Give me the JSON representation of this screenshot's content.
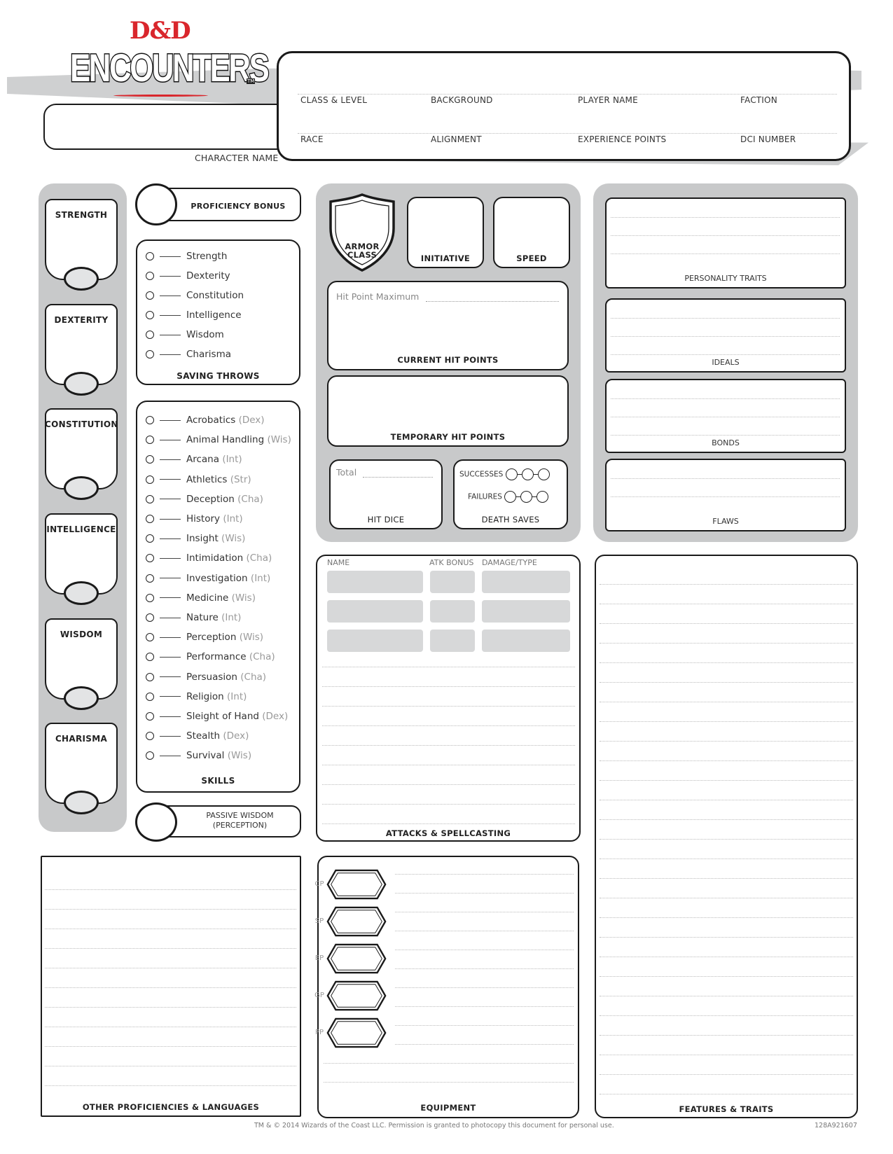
{
  "header": {
    "brand": "D&D",
    "title": "ENCOUNTERS",
    "tm": "TM",
    "character_name_label": "CHARACTER NAME",
    "fields_row1": [
      "CLASS & LEVEL",
      "BACKGROUND",
      "PLAYER NAME",
      "FACTION"
    ],
    "fields_row2": [
      "RACE",
      "ALIGNMENT",
      "EXPERIENCE POINTS",
      "DCI NUMBER"
    ]
  },
  "abilities": [
    "STRENGTH",
    "DEXTERITY",
    "CONSTITUTION",
    "INTELLIGENCE",
    "WISDOM",
    "CHARISMA"
  ],
  "proficiency_bonus_label": "PROFICIENCY BONUS",
  "saving_throws": {
    "title": "SAVING THROWS",
    "items": [
      "Strength",
      "Dexterity",
      "Constitution",
      "Intelligence",
      "Wisdom",
      "Charisma"
    ]
  },
  "skills": {
    "title": "SKILLS",
    "items": [
      {
        "name": "Acrobatics",
        "attr": "(Dex)"
      },
      {
        "name": "Animal Handling",
        "attr": "(Wis)"
      },
      {
        "name": "Arcana",
        "attr": "(Int)"
      },
      {
        "name": "Athletics",
        "attr": "(Str)"
      },
      {
        "name": "Deception",
        "attr": "(Cha)"
      },
      {
        "name": "History",
        "attr": "(Int)"
      },
      {
        "name": "Insight",
        "attr": "(Wis)"
      },
      {
        "name": "Intimidation",
        "attr": "(Cha)"
      },
      {
        "name": "Investigation",
        "attr": "(Int)"
      },
      {
        "name": "Medicine",
        "attr": "(Wis)"
      },
      {
        "name": "Nature",
        "attr": "(Int)"
      },
      {
        "name": "Perception",
        "attr": "(Wis)"
      },
      {
        "name": "Performance",
        "attr": "(Cha)"
      },
      {
        "name": "Persuasion",
        "attr": "(Cha)"
      },
      {
        "name": "Religion",
        "attr": "(Int)"
      },
      {
        "name": "Sleight of Hand",
        "attr": "(Dex)"
      },
      {
        "name": "Stealth",
        "attr": "(Dex)"
      },
      {
        "name": "Survival",
        "attr": "(Wis)"
      }
    ]
  },
  "passive_wisdom": {
    "line1": "PASSIVE WISDOM",
    "line2": "(PERCEPTION)"
  },
  "combat": {
    "armor_class_line1": "ARMOR",
    "armor_class_line2": "CLASS",
    "initiative": "INITIATIVE",
    "speed": "SPEED",
    "hp_max_label": "Hit Point Maximum",
    "current_hp": "CURRENT HIT POINTS",
    "temp_hp": "TEMPORARY HIT POINTS",
    "hit_dice_total": "Total",
    "hit_dice": "HIT DICE",
    "successes": "SUCCESSES",
    "failures": "FAILURES",
    "death_saves": "DEATH SAVES"
  },
  "traits": [
    "PERSONALITY TRAITS",
    "IDEALS",
    "BONDS",
    "FLAWS"
  ],
  "attacks": {
    "col_name": "NAME",
    "col_atk": "ATK BONUS",
    "col_dmg": "DAMAGE/TYPE",
    "title": "ATTACKS & SPELLCASTING"
  },
  "other_proficiencies": "OTHER PROFICIENCIES & LANGUAGES",
  "equipment": {
    "title": "EQUIPMENT",
    "coins": [
      "CP",
      "SP",
      "EP",
      "GP",
      "PP"
    ]
  },
  "features": "FEATURES & TRAITS",
  "footer": {
    "copyright": "TM & © 2014 Wizards of the Coast LLC. Permission is granted to photocopy this document for personal use.",
    "code": "128A921607"
  },
  "colors": {
    "brand_red": "#d9262c",
    "panel_gray": "#c8c9ca",
    "ink": "#1a1a1a"
  }
}
